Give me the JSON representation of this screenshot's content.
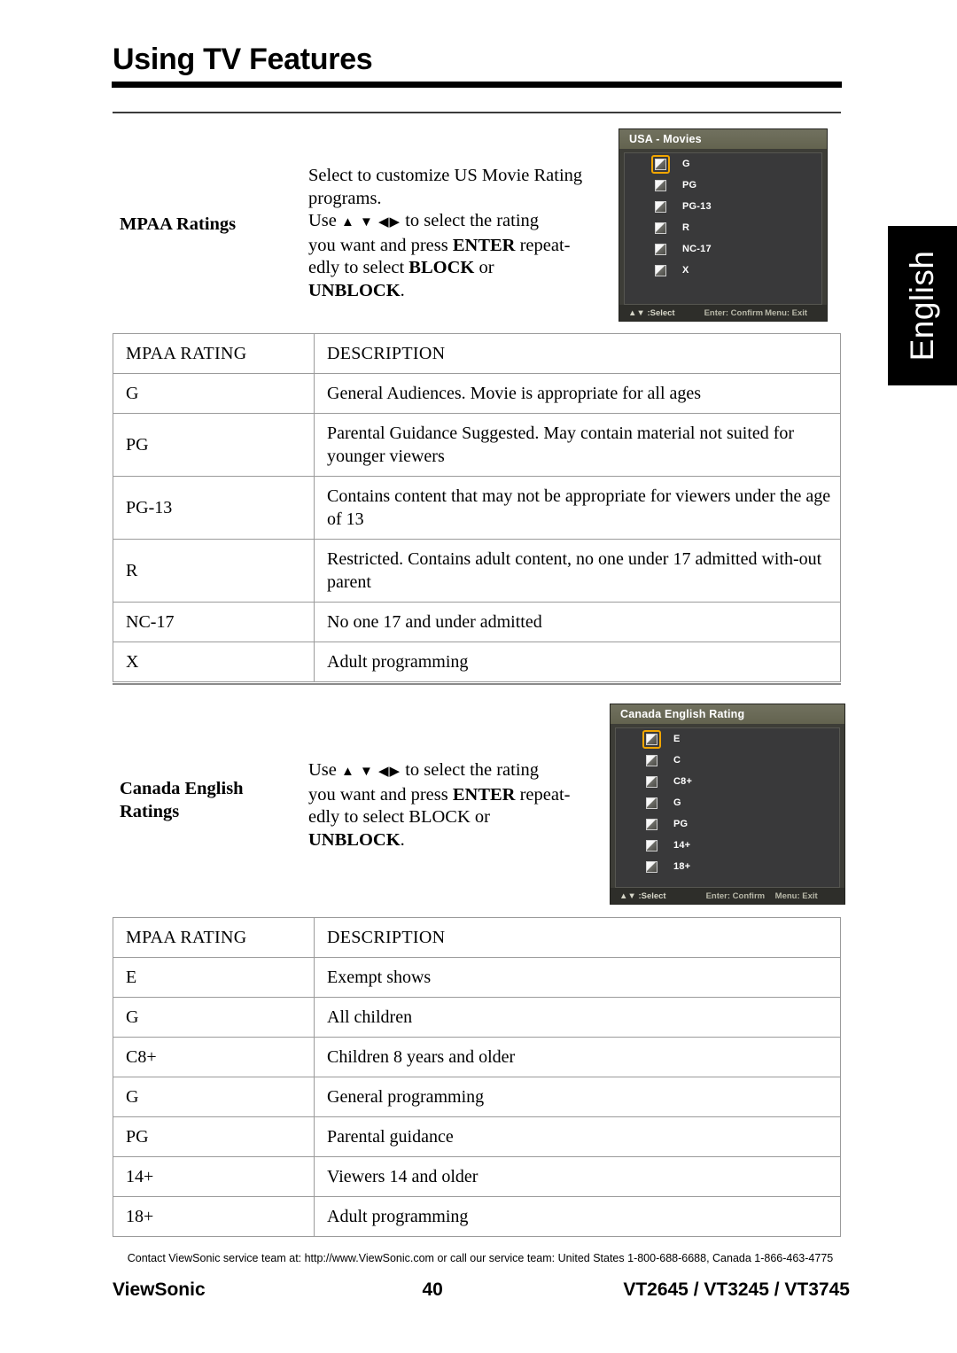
{
  "header": {
    "title": "Using TV Features"
  },
  "side_tab": {
    "label": "English"
  },
  "sections": [
    {
      "id": "mpaa",
      "label": "MPAA Ratings",
      "body_line1": "Select to customize US Movie Rating",
      "body_line2": "programs.",
      "body_use": "Use",
      "body_after_arrows": "to select the rating",
      "body_line4a": "you want and press ",
      "body_enter": "ENTER",
      "body_line4b": " repeat-",
      "body_line5a": "edly to select ",
      "body_block": "BLOCK",
      "body_line5b": " or",
      "body_unblock": "UNBLOCK",
      "body_period": "."
    },
    {
      "id": "canada-english",
      "label_line1": "Canada English",
      "label_line2": "Ratings",
      "body_use": "Use",
      "body_after_arrows": "to select the rating",
      "body_line2a": "you want and press ",
      "body_enter": "ENTER",
      "body_line2b": " repeat-",
      "body_line3": "edly to select BLOCK or",
      "body_unblock": "UNBLOCK",
      "body_period": "."
    }
  ],
  "osd_usa_movies": {
    "title": "USA - Movies",
    "items": [
      {
        "label": "G",
        "focused": true
      },
      {
        "label": "PG",
        "focused": false
      },
      {
        "label": "PG-13",
        "focused": false
      },
      {
        "label": "R",
        "focused": false
      },
      {
        "label": "NC-17",
        "focused": false
      },
      {
        "label": "X",
        "focused": false
      }
    ],
    "footer": {
      "select": "▲▼ :Select",
      "confirm": "Enter: Confirm",
      "exit": "Menu: Exit"
    }
  },
  "osd_canada_english": {
    "title": "Canada English Rating",
    "items": [
      {
        "label": "E",
        "focused": true
      },
      {
        "label": "C",
        "focused": false
      },
      {
        "label": "C8+",
        "focused": false
      },
      {
        "label": "G",
        "focused": false
      },
      {
        "label": "PG",
        "focused": false
      },
      {
        "label": "14+",
        "focused": false
      },
      {
        "label": "18+",
        "focused": false
      }
    ],
    "footer": {
      "select": "▲▼ :Select",
      "confirm": "Enter: Confirm",
      "exit": "Menu: Exit"
    }
  },
  "table_mpaa": {
    "headers": [
      "MPAA RATING",
      "DESCRIPTION"
    ],
    "rows": [
      [
        "G",
        "General Audiences. Movie is appropriate for all ages"
      ],
      [
        "PG",
        "Parental Guidance Suggested. May contain material not suited for younger viewers"
      ],
      [
        "PG-13",
        "Contains content that may not be appropriate for viewers under the age of 13"
      ],
      [
        "R",
        "Restricted. Contains adult content, no one under 17 admitted with-out parent"
      ],
      [
        "NC-17",
        "No one 17 and under admitted"
      ],
      [
        "X",
        "Adult programming"
      ]
    ]
  },
  "table_canada": {
    "headers": [
      "MPAA RATING",
      "DESCRIPTION"
    ],
    "rows": [
      [
        "E",
        "Exempt shows"
      ],
      [
        "G",
        "All children"
      ],
      [
        "C8+",
        "Children 8 years and older"
      ],
      [
        "G",
        "General programming"
      ],
      [
        "PG",
        "Parental guidance"
      ],
      [
        "14+",
        "Viewers 14 and older"
      ],
      [
        "18+",
        "Adult programming"
      ]
    ]
  },
  "footer": {
    "contact": "Contact ViewSonic service team at: http://www.ViewSonic.com or call our service team: United States 1-800-688-6688, Canada 1-866-463-4775",
    "brand": "ViewSonic",
    "page_number": "40",
    "models": "VT2645 / VT3245 / VT3745"
  },
  "colors": {
    "focus_highlight": "#f0a500",
    "osd_title_bar": "#6a6a57",
    "osd_body": "#39393a",
    "rule": "#000000"
  }
}
